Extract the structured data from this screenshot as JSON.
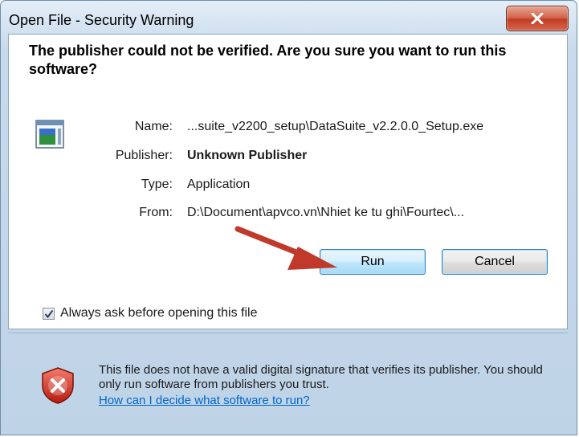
{
  "window": {
    "title": "Open File - Security Warning",
    "close_symbol": "X"
  },
  "headline": "The publisher could not be verified.  Are you sure you want to run this software?",
  "details": {
    "name_label": "Name:",
    "name_value": "...suite_v2200_setup\\DataSuite_v2.2.0.0_Setup.exe",
    "publisher_label": "Publisher:",
    "publisher_value": "Unknown Publisher",
    "type_label": "Type:",
    "type_value": "Application",
    "from_label": "From:",
    "from_value": "D:\\Document\\apvco.vn\\Nhiet ke tu ghi\\Fourtec\\..."
  },
  "buttons": {
    "run": "Run",
    "cancel": "Cancel"
  },
  "checkbox": {
    "label": "Always ask before opening this file",
    "checked": true
  },
  "warning": {
    "text": "This file does not have a valid digital signature that verifies its publisher.  You should only run software from publishers you trust.",
    "link": "How can I decide what software to run?"
  },
  "icons": [
    "close-icon",
    "application-file-icon",
    "red-arrow-annotation",
    "checkmark-icon",
    "security-shield-icon"
  ],
  "colors": {
    "arrow": "#c0392b",
    "close_button": "#c94a30",
    "link": "#0066cc"
  }
}
